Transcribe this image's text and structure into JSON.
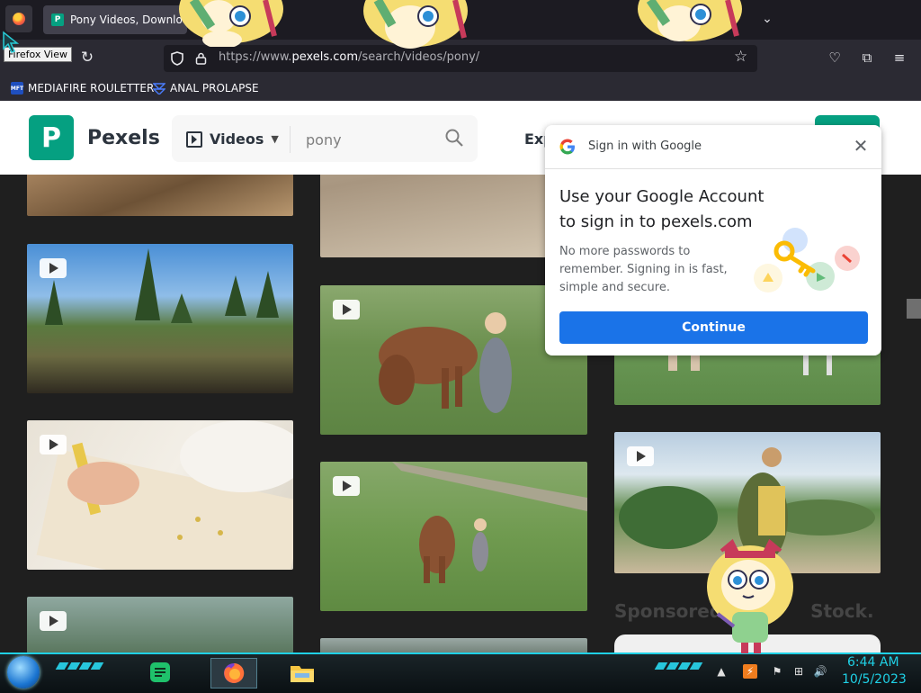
{
  "browser": {
    "tab_title": "Pony Videos, Download",
    "tooltip": "Firefox View",
    "url_prefix": "https://www.",
    "url_domain": "pexels.com",
    "url_path": "/search/videos/pony/",
    "bookmarks": [
      {
        "label": "MEDIAFIRE ROULETTER",
        "icon": "MFT"
      },
      {
        "label": "ANAL PROLAPSE",
        "icon": "bookmark-icon"
      }
    ]
  },
  "pexels": {
    "logo_text": "Pexels",
    "logo_letter": "P",
    "media_type": "Videos",
    "search_value": "pony",
    "nav_partial": "Exp",
    "sponsored_partial": "Sponsored",
    "sponsored_suffix": "Stock."
  },
  "google_popup": {
    "header": "Sign in with Google",
    "title": "Use your Google Account to sign in to pexels.com",
    "body": "No more passwords to remember. Signing in is fast, simple and secure.",
    "button": "Continue"
  },
  "taskbar": {
    "time": "6:44 AM",
    "date": "10/5/2023"
  },
  "colors": {
    "pexels_green": "#05a081",
    "google_blue": "#1a73e8",
    "taskbar_accent": "#1fd1e6"
  }
}
